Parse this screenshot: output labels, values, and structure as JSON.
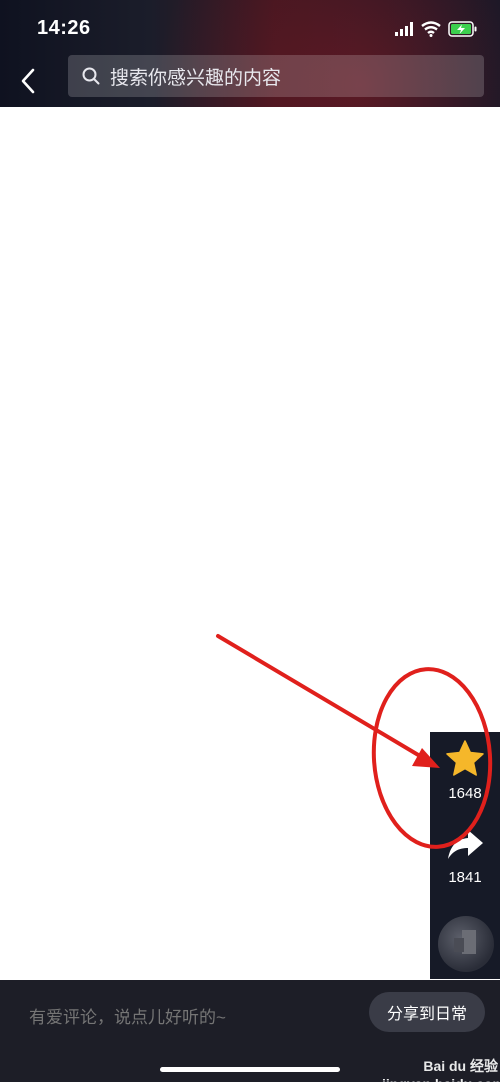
{
  "status_bar": {
    "time": "14:26"
  },
  "header": {
    "search_placeholder": "搜索你感兴趣的内容",
    "back_icon": "chevron-left-icon",
    "search_icon": "search-icon"
  },
  "actions": {
    "favorite_count": "1648",
    "share_count": "1841",
    "favorite_icon": "star-icon",
    "share_icon": "share-arrow-icon"
  },
  "bottom": {
    "comment_placeholder": "有爱评论，说点儿好听的~",
    "share_daily_label": "分享到日常"
  },
  "watermark": {
    "text": "Bai du 经验 jingyan.baidu.com"
  },
  "colors": {
    "accent_star": "#f5b72a",
    "annotation_red": "#e0201c",
    "bar_dark": "#1d1e27"
  }
}
